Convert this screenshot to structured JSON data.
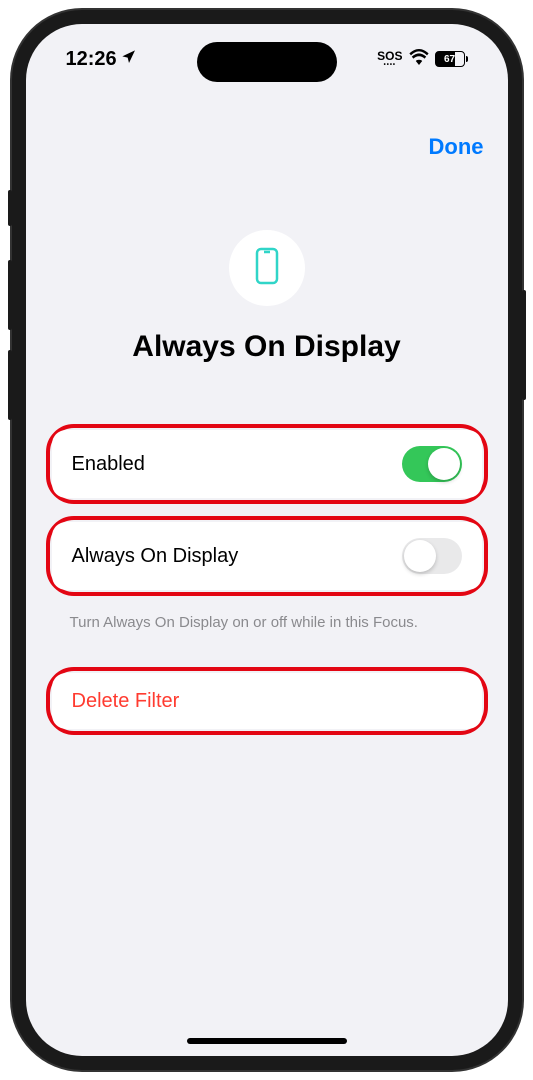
{
  "status_bar": {
    "time": "12:26",
    "sos": "SOS",
    "battery": "67"
  },
  "nav": {
    "done": "Done"
  },
  "header": {
    "title": "Always On Display"
  },
  "settings": {
    "enabled": {
      "label": "Enabled",
      "value": true
    },
    "aod": {
      "label": "Always On Display",
      "value": false
    },
    "footer": "Turn Always On Display on or off while in this Focus."
  },
  "delete": {
    "label": "Delete Filter"
  }
}
